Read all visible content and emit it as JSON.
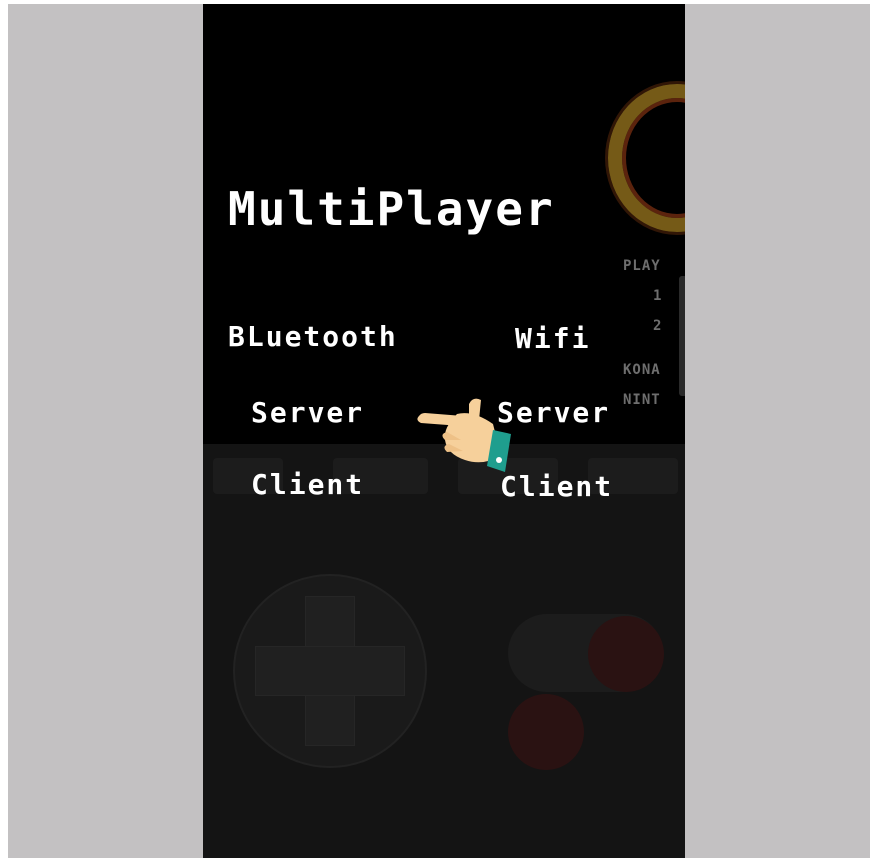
{
  "menu": {
    "title": "MultiPlayer",
    "columns": [
      {
        "header": "BLuetooth",
        "server": "Server",
        "client": "Client"
      },
      {
        "header": "Wifi",
        "server": "Server",
        "client": "Client"
      }
    ]
  },
  "background": {
    "player_select_label": "PLAY",
    "option_1": "1",
    "option_2": "2",
    "publisher_1": "KONA",
    "publisher_2": "NINT"
  },
  "icons": {
    "pointer": "pointing-hand-icon",
    "dpad": "dpad-icon"
  },
  "colors": {
    "overlay_text": "#ffffff",
    "screen_bg": "#000000",
    "frame": "#c3c1c2",
    "hand_skin": "#f6d09b",
    "hand_cuff": "#1f9e8e"
  }
}
